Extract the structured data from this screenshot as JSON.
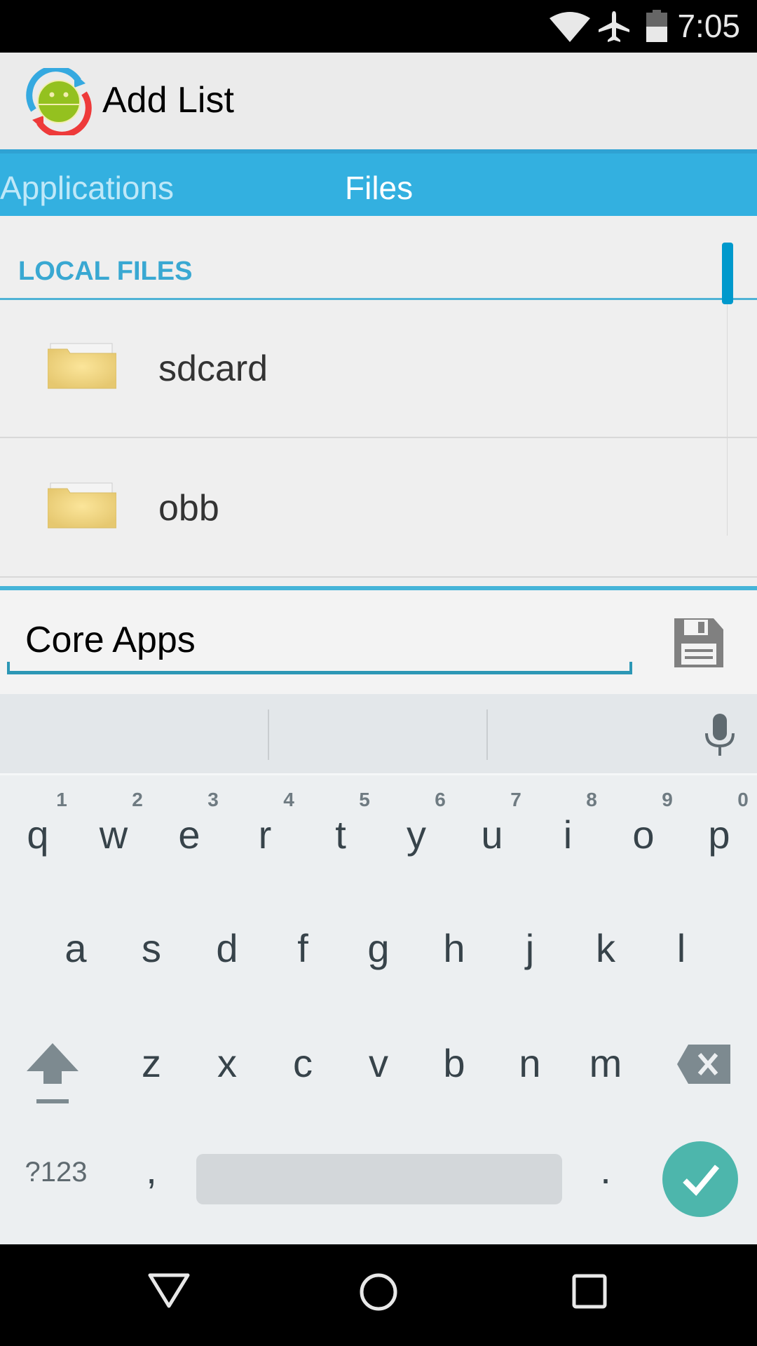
{
  "status_bar": {
    "time": "7:05",
    "icons": [
      "wifi-icon",
      "airplane-mode-icon",
      "battery-icon"
    ],
    "battery_level_percent": 50
  },
  "action_bar": {
    "title": "Add List",
    "logo_icon": "app-logo-android-sync-icon"
  },
  "tabs": [
    {
      "label": "Applications",
      "active": false
    },
    {
      "label": "Files",
      "active": true
    }
  ],
  "content": {
    "section_header": "LOCAL FILES",
    "files": [
      {
        "name": "sdcard",
        "icon": "folder-icon"
      },
      {
        "name": "obb",
        "icon": "folder-icon"
      }
    ]
  },
  "name_bar": {
    "input_value": "Core Apps",
    "save_icon": "save-floppy-icon"
  },
  "keyboard": {
    "row1": [
      {
        "key": "q",
        "hint": "1"
      },
      {
        "key": "w",
        "hint": "2"
      },
      {
        "key": "e",
        "hint": "3"
      },
      {
        "key": "r",
        "hint": "4"
      },
      {
        "key": "t",
        "hint": "5"
      },
      {
        "key": "y",
        "hint": "6"
      },
      {
        "key": "u",
        "hint": "7"
      },
      {
        "key": "i",
        "hint": "8"
      },
      {
        "key": "o",
        "hint": "9"
      },
      {
        "key": "p",
        "hint": "0"
      }
    ],
    "row2": [
      "a",
      "s",
      "d",
      "f",
      "g",
      "h",
      "j",
      "k",
      "l"
    ],
    "row3": [
      "z",
      "x",
      "c",
      "v",
      "b",
      "n",
      "m"
    ],
    "symbols_label": "?123",
    "comma": ",",
    "period": ".",
    "accent_color": "#4db6ac"
  },
  "colors": {
    "tab_bar": "#33b0e0",
    "section_header": "#39a8d2",
    "input_underline": "#2c97b5"
  }
}
